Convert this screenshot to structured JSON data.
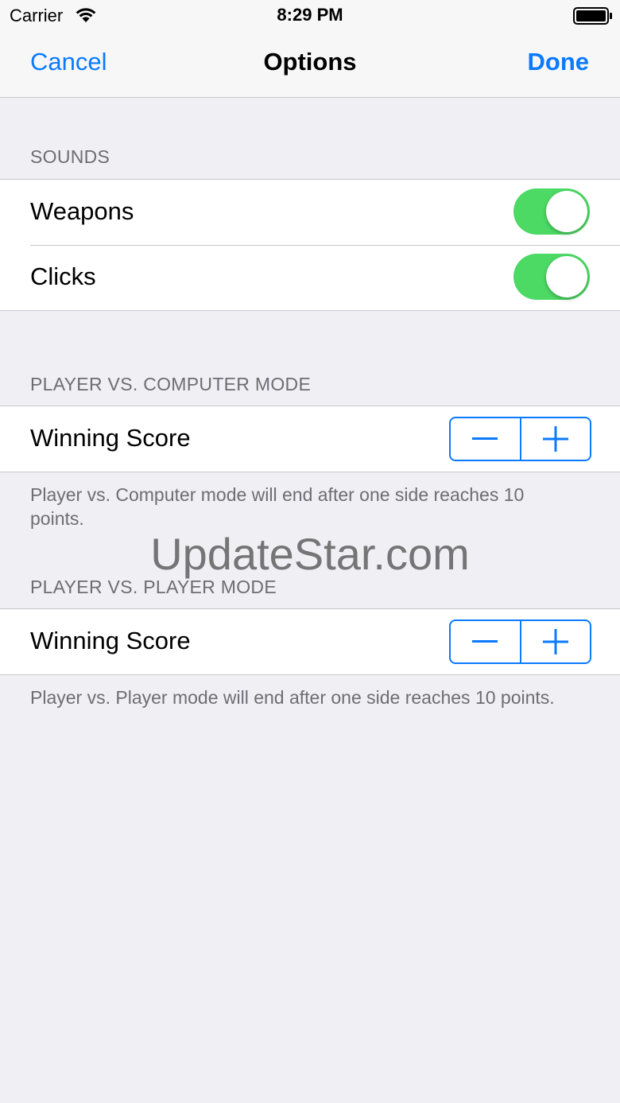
{
  "status_bar": {
    "carrier": "Carrier",
    "time": "8:29 PM",
    "wifi_icon": "wifi-icon",
    "battery_icon": "battery-icon"
  },
  "nav": {
    "cancel_label": "Cancel",
    "title": "Options",
    "done_label": "Done"
  },
  "sections": [
    {
      "header": "SOUNDS",
      "rows": [
        {
          "label": "Weapons",
          "control": "toggle",
          "on": true
        },
        {
          "label": "Clicks",
          "control": "toggle",
          "on": true
        }
      ]
    },
    {
      "header": "PLAYER VS. COMPUTER MODE",
      "rows": [
        {
          "label": "Winning Score",
          "control": "stepper",
          "decrement_icon": "minus-icon",
          "increment_icon": "plus-icon"
        }
      ],
      "footer": "Player vs. Computer mode will end after one side reaches 10 points."
    },
    {
      "header": "PLAYER VS. PLAYER MODE",
      "rows": [
        {
          "label": "Winning Score",
          "control": "stepper",
          "decrement_icon": "minus-icon",
          "increment_icon": "plus-icon"
        }
      ],
      "footer": "Player vs. Player mode will end after one side reaches 10 points."
    }
  ],
  "watermark": "UpdateStar.com",
  "colors": {
    "accent": "#0a7aff",
    "toggle_on": "#4cd964",
    "background": "#efeff4",
    "secondary_text": "#6d6d72"
  }
}
